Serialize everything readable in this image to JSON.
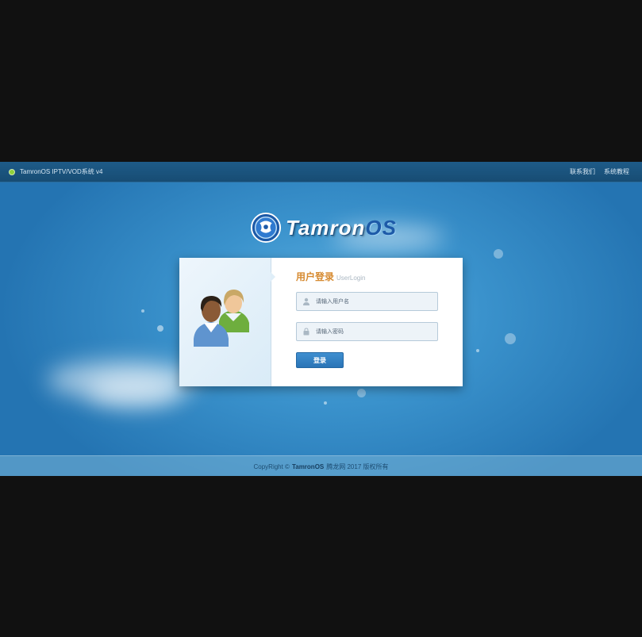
{
  "window": {
    "title": "TamronOS IPTV/VOD系统 v4"
  },
  "topbar": {
    "links": [
      "联系我们",
      "系统教程"
    ]
  },
  "logo": {
    "text_primary": "Tamron",
    "text_secondary": "OS"
  },
  "login": {
    "title_zh": "用户登录",
    "title_en": "UserLogin",
    "username_placeholder": "请输入用户名",
    "password_placeholder": "请输入密码",
    "username_value": "",
    "password_value": "",
    "submit_label": "登录"
  },
  "footer": {
    "prefix": "CopyRight ©",
    "brand": "TamronOS",
    "suffix": "腾龙网 2017 版权所有"
  },
  "colors": {
    "accent": "#2a74b6",
    "title_orange": "#d68a30",
    "status_green": "#8fd13a"
  },
  "icons": [
    "status-dot-icon",
    "logo-icon",
    "users-icon",
    "user-icon",
    "lock-icon"
  ]
}
